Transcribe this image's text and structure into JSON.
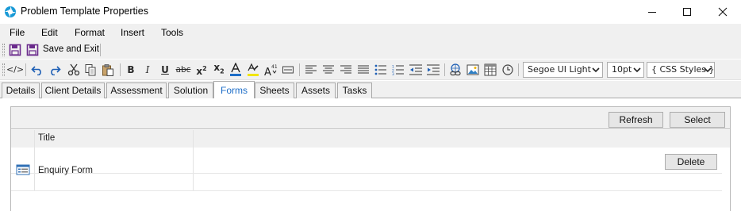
{
  "window": {
    "title": "Problem Template Properties",
    "app_icon": "app-logo-icon",
    "controls": [
      "minimize-icon",
      "maximize-icon",
      "close-icon"
    ]
  },
  "menu": {
    "items": [
      "File",
      "Edit",
      "Format",
      "Insert",
      "Tools"
    ]
  },
  "toolbar": {
    "save_label": "Save and Exit",
    "font_family": "Segoe UI Light",
    "font_size": "10pt",
    "css_styles": "{ CSS Styles }"
  },
  "tabs": {
    "items": [
      "Details",
      "Client Details",
      "Assessment",
      "Solution",
      "Forms",
      "Sheets",
      "Assets",
      "Tasks"
    ],
    "active": "Forms"
  },
  "forms_panel": {
    "refresh_label": "Refresh",
    "select_label": "Select",
    "columns": [
      "Title"
    ],
    "rows": [
      {
        "title": "Enquiry Form",
        "delete_label": "Delete"
      }
    ]
  },
  "colors": {
    "accent": "#1e6ec8",
    "toolbar_bg": "#f0f0f0",
    "save_icon": "#6a2a8c",
    "undo_redo": "#1e5fb5"
  }
}
